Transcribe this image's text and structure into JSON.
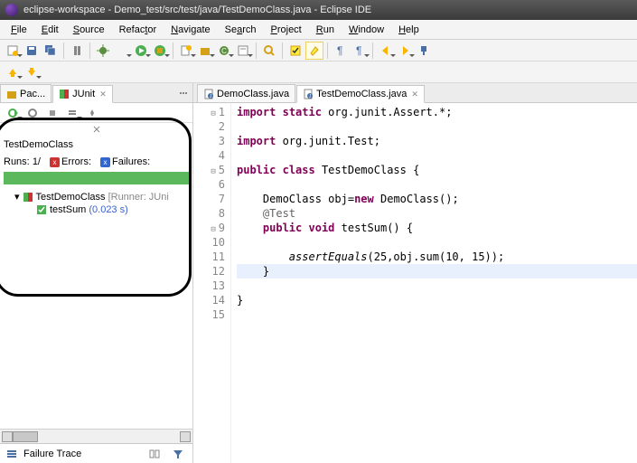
{
  "title": "eclipse-workspace - Demo_test/src/test/java/TestDemoClass.java - Eclipse IDE",
  "menu": [
    "File",
    "Edit",
    "Source",
    "Refactor",
    "Navigate",
    "Search",
    "Project",
    "Run",
    "Window",
    "Help"
  ],
  "left": {
    "tabs": [
      {
        "icon": "package-icon",
        "label": "Pac..."
      },
      {
        "icon": "junit-icon",
        "label": "JUnit",
        "active": true
      }
    ],
    "junit": {
      "class": "TestDemoClass",
      "runs_label": "Runs:",
      "runs_value": "1/",
      "errors_label": "Errors:",
      "failures_label": "Failures:",
      "tree": {
        "suite_label": "TestDemoClass",
        "suite_runner": "[Runner: JUni",
        "test_label": "testSum",
        "test_time": "(0.023 s)"
      },
      "failure_trace_label": "Failure Trace"
    }
  },
  "editor": {
    "tabs": [
      {
        "label": "DemoClass.java",
        "active": false
      },
      {
        "label": "TestDemoClass.java",
        "active": true
      }
    ],
    "lines": [
      {
        "n": "1",
        "html": "<span class='kw'>import</span> <span class='kw'>static</span> org.junit.Assert.*;"
      },
      {
        "n": "2",
        "html": ""
      },
      {
        "n": "3",
        "html": "<span class='kw'>import</span> org.junit.Test;"
      },
      {
        "n": "4",
        "html": ""
      },
      {
        "n": "5",
        "html": "<span class='kw'>public</span> <span class='kw'>class</span> TestDemoClass {"
      },
      {
        "n": "6",
        "html": ""
      },
      {
        "n": "7",
        "html": "    DemoClass <span class='type'>obj</span>=<span class='kw'>new</span> DemoClass();"
      },
      {
        "n": "8",
        "html": "    <span class='ann'>@Test</span>"
      },
      {
        "n": "9",
        "html": "    <span class='kw'>public</span> <span class='kw'>void</span> testSum() {"
      },
      {
        "n": "10",
        "html": ""
      },
      {
        "n": "11",
        "html": "        <span class='meth'>assertEquals</span>(25,obj.sum(10, 15));"
      },
      {
        "n": "12",
        "html": "    }",
        "hl": true
      },
      {
        "n": "13",
        "html": ""
      },
      {
        "n": "14",
        "html": "}"
      },
      {
        "n": "15",
        "html": ""
      }
    ]
  }
}
